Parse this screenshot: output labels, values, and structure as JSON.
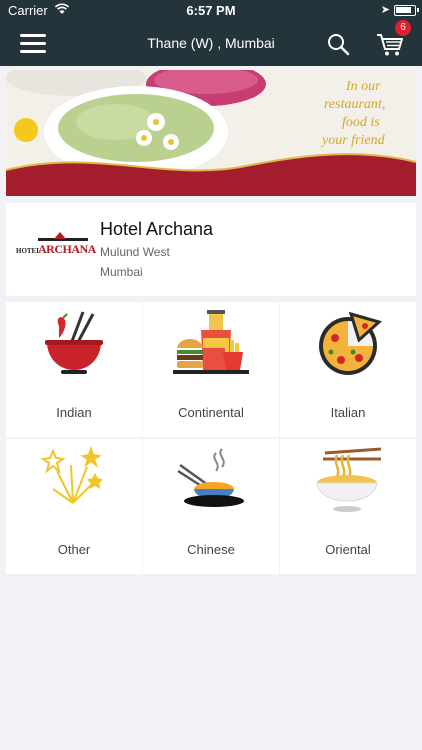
{
  "status_bar": {
    "carrier": "Carrier",
    "time": "6:57 PM"
  },
  "navbar": {
    "location": "Thane (W) , Mumbai",
    "cart_count": "6"
  },
  "banner": {
    "tagline_line1": "In our",
    "tagline_line2": "restaurant,",
    "tagline_line3": "food is",
    "tagline_line4": "your friend"
  },
  "restaurant": {
    "logo_small": "HOTEL",
    "logo_big": "ARCHANA",
    "name": "Hotel Archana",
    "area": "Mulund West",
    "city": "Mumbai"
  },
  "categories": [
    {
      "label": "Indian",
      "icon": "bowl-chopsticks-icon"
    },
    {
      "label": "Continental",
      "icon": "burger-fries-icon"
    },
    {
      "label": "Italian",
      "icon": "pizza-icon"
    },
    {
      "label": "Other",
      "icon": "sparkle-stars-icon"
    },
    {
      "label": "Chinese",
      "icon": "noodle-bowl-icon"
    },
    {
      "label": "Oriental",
      "icon": "ramen-bowl-icon"
    }
  ],
  "colors": {
    "header": "#23343a",
    "badge": "#e2202d",
    "brand_red": "#b01c24"
  }
}
